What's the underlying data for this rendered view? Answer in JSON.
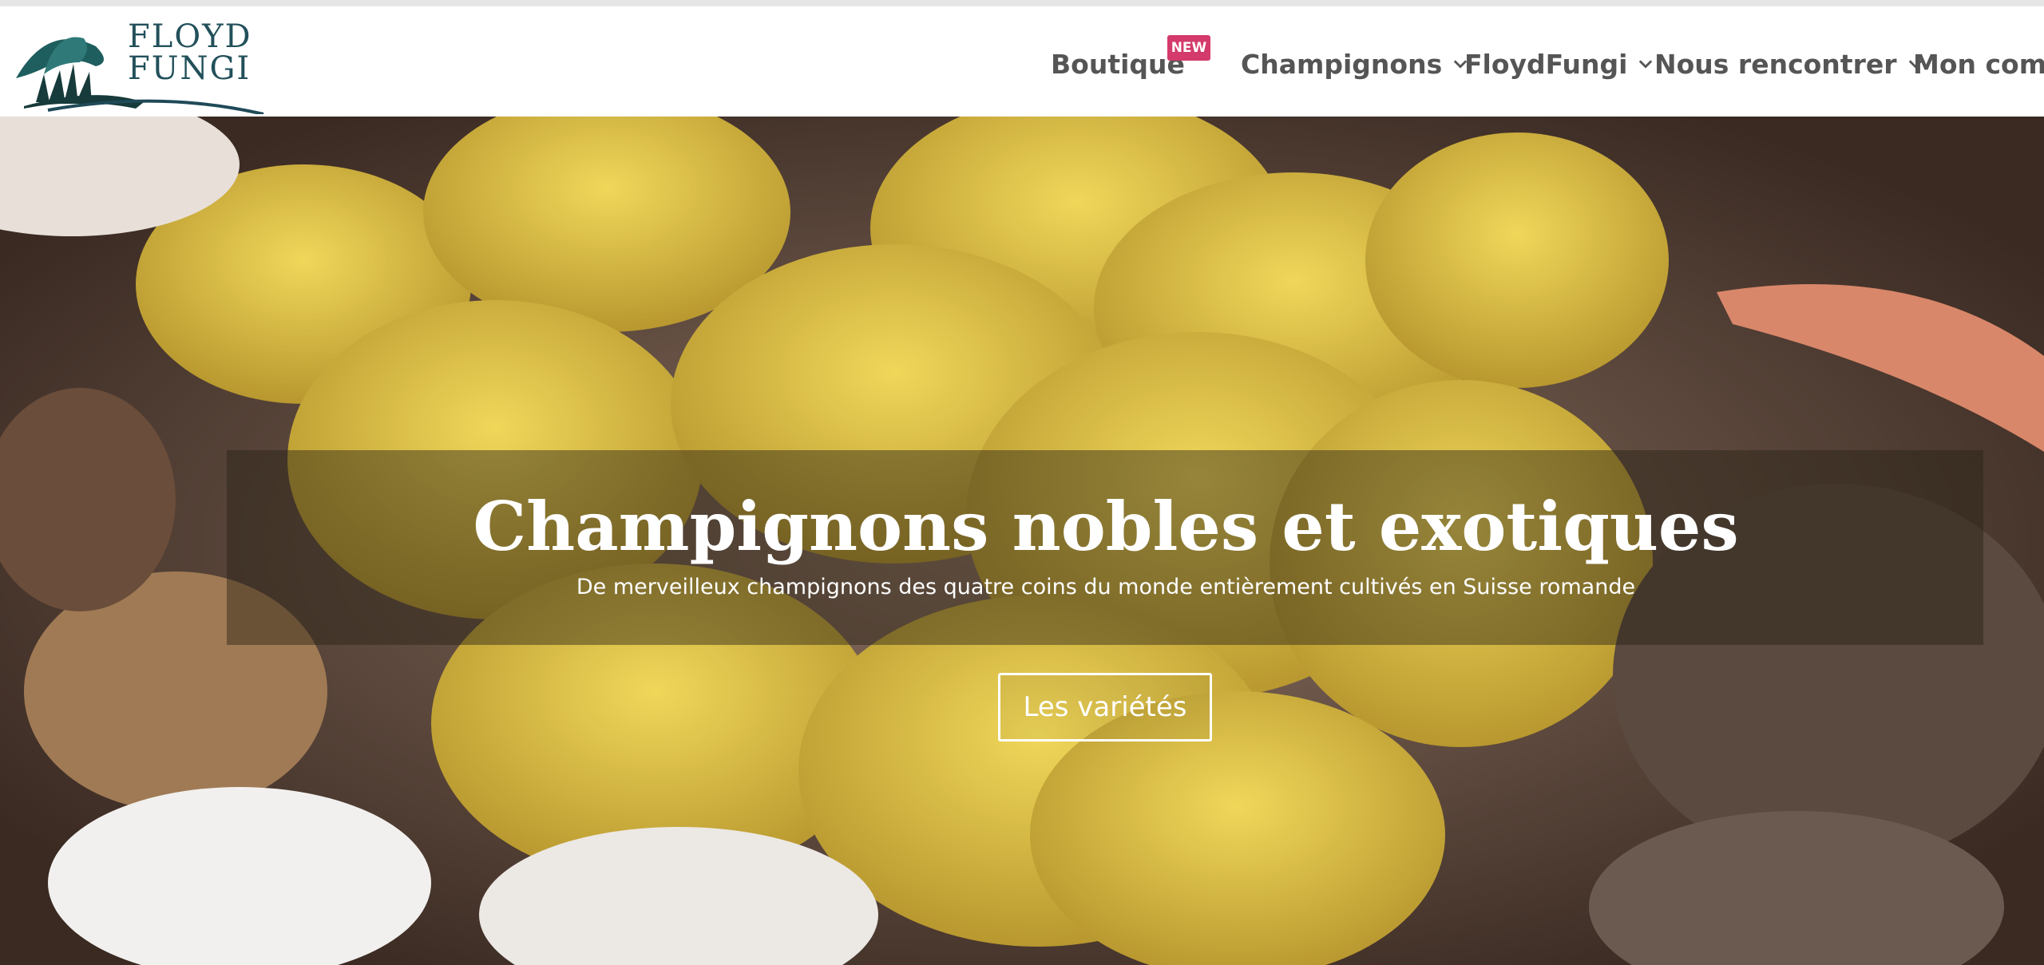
{
  "logo": {
    "line1": "FLOYD",
    "line2": "FUNGI"
  },
  "nav": {
    "items": [
      {
        "label": "Boutique",
        "badge": "NEW",
        "has_dropdown": false
      },
      {
        "label": "Champignons",
        "has_dropdown": true
      },
      {
        "label": "FloydFungi",
        "has_dropdown": true
      },
      {
        "label": "Nous rencontrer",
        "has_dropdown": true
      },
      {
        "label": "Mon compte",
        "has_dropdown": false
      }
    ]
  },
  "hero": {
    "title": "Champignons nobles et exotiques",
    "subtitle": "De merveilleux champignons des quatre coins du monde entièrement cultivés en Suisse romande",
    "cta_label": "Les variétés"
  },
  "colors": {
    "brand": "#22505a",
    "badge": "#d43a6b",
    "nav_text": "#555555"
  }
}
